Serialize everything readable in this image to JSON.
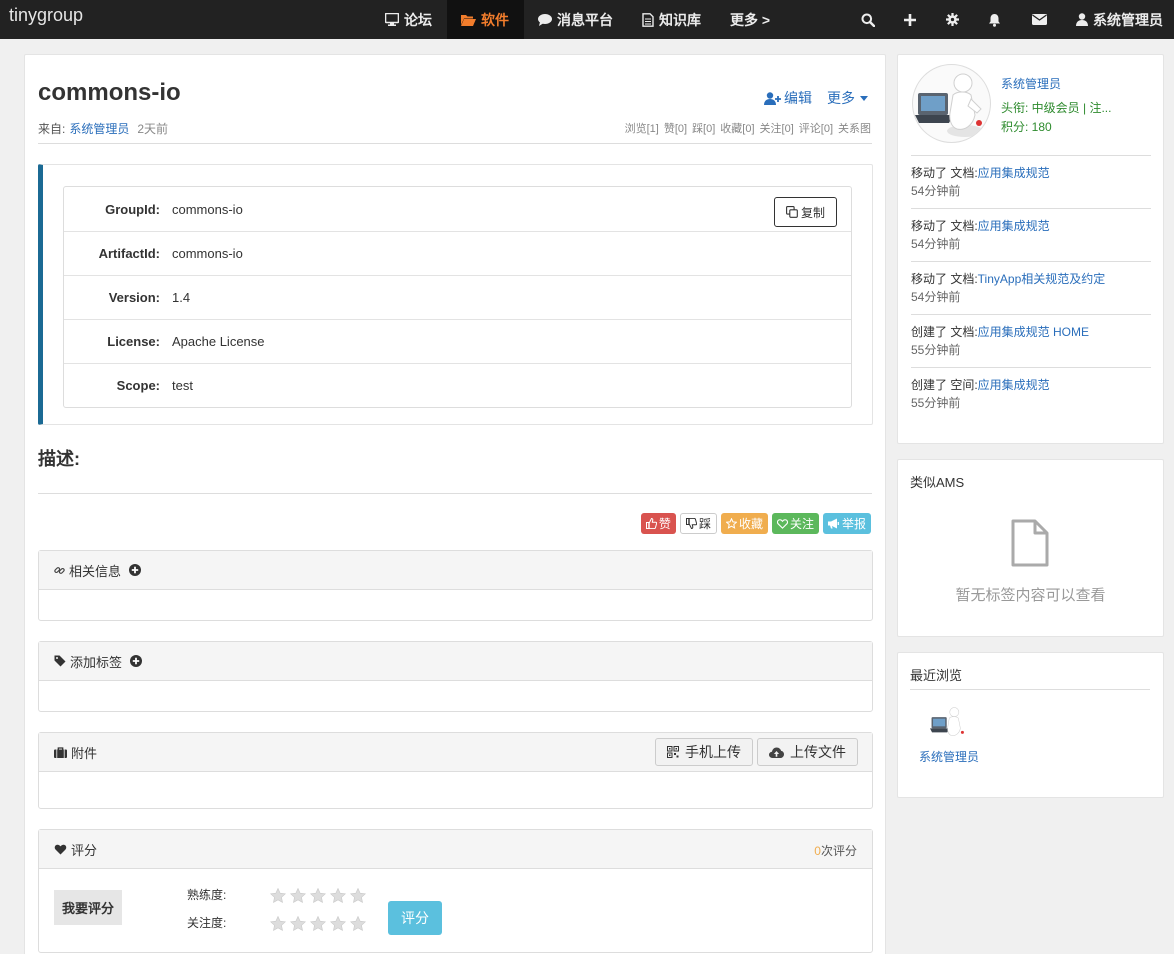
{
  "nav": {
    "brand": "tinygroup",
    "items": [
      {
        "label": "论坛",
        "icon": "monitor-icon"
      },
      {
        "label": "软件",
        "icon": "folder-open-icon",
        "active": true
      },
      {
        "label": "消息平台",
        "icon": "comment-icon"
      },
      {
        "label": "知识库",
        "icon": "file-text-icon"
      },
      {
        "label": "更多 >"
      }
    ],
    "icons": [
      "search-icon",
      "plus-icon",
      "gear-icon",
      "bell-icon",
      "envelope-icon"
    ],
    "user": "系统管理员",
    "active_color": "#f27d2c"
  },
  "artifact": {
    "title": "commons-io",
    "edit_label": "编辑",
    "more_label": "更多",
    "from_label": "来自:",
    "author": "系统管理员",
    "time": "2天前",
    "stats": [
      "浏览[1]",
      "赞[0]",
      "踩[0]",
      "收藏[0]",
      "关注[0]",
      "评论[0]",
      "关系图"
    ],
    "copy_label": "复制",
    "fields": [
      {
        "key": "GroupId:",
        "value": "commons-io"
      },
      {
        "key": "ArtifactId:",
        "value": "commons-io"
      },
      {
        "key": "Version:",
        "value": "1.4"
      },
      {
        "key": "License:",
        "value": "Apache License"
      },
      {
        "key": "Scope:",
        "value": "test"
      }
    ],
    "desc_label": "描述:"
  },
  "votes": [
    {
      "label": "赞",
      "icon": "thumbs-up-icon",
      "color": "#d9534f"
    },
    {
      "label": "踩",
      "icon": "thumbs-down-icon",
      "color": "#ffffff"
    },
    {
      "label": "收藏",
      "icon": "star-icon",
      "color": "#f0ad4e"
    },
    {
      "label": "关注",
      "icon": "heart-icon",
      "color": "#5cb85c"
    },
    {
      "label": "举报",
      "icon": "bullhorn-icon",
      "color": "#5bc0de"
    }
  ],
  "panels": {
    "related": "相关信息",
    "tags": "添加标签",
    "attachments": "附件",
    "mobile_upload": "手机上传",
    "upload_file": "上传文件",
    "rating": "评分",
    "rating_count": "0",
    "rating_count_suffix": "次评分",
    "rate_me": "我要评分",
    "proficiency": "熟练度:",
    "attention": "关注度:",
    "rate_button": "评分"
  },
  "profile": {
    "name": "系统管理员",
    "title": "头衔:  中级会员 | 注...",
    "score": "积分:  180"
  },
  "activities": [
    {
      "action": "移动了 文档:",
      "target": "应用集成规范",
      "time": "54分钟前"
    },
    {
      "action": "移动了 文档:",
      "target": "应用集成规范",
      "time": "54分钟前"
    },
    {
      "action": "移动了 文档:",
      "target": "TinyApp相关规范及约定",
      "time": "54分钟前"
    },
    {
      "action": "创建了 文档:",
      "target": "应用集成规范 HOME",
      "time": "55分钟前"
    },
    {
      "action": "创建了 空间:",
      "target": "应用集成规范",
      "time": "55分钟前"
    }
  ],
  "similar": {
    "title": "类似AMS",
    "empty": "暂无标签内容可以查看"
  },
  "recent": {
    "title": "最近浏览",
    "user": "系统管理员"
  }
}
